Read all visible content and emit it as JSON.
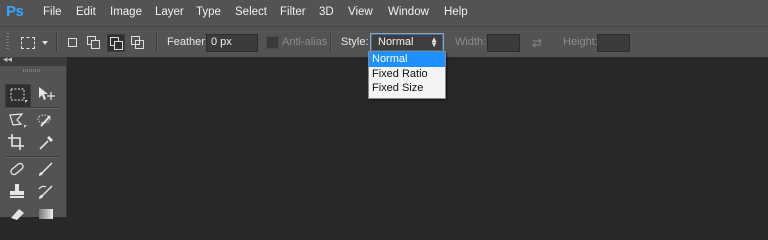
{
  "app": {
    "logo": "Ps"
  },
  "menu": [
    "File",
    "Edit",
    "Image",
    "Layer",
    "Type",
    "Select",
    "Filter",
    "3D",
    "View",
    "Window",
    "Help"
  ],
  "options": {
    "feather_label": "Feather:",
    "feather_value": "0 px",
    "antialias_label": "Anti-alias",
    "style_label": "Style:",
    "style_value": "Normal",
    "width_label": "Width:",
    "width_value": "",
    "height_label": "Height:",
    "height_value": ""
  },
  "style_dropdown": {
    "items": [
      "Normal",
      "Fixed Ratio",
      "Fixed Size"
    ],
    "selected": "Normal"
  },
  "colors": {
    "chrome": "#535353",
    "canvas": "#282828",
    "accent": "#31a8ff",
    "selection": "#1e90ff"
  }
}
